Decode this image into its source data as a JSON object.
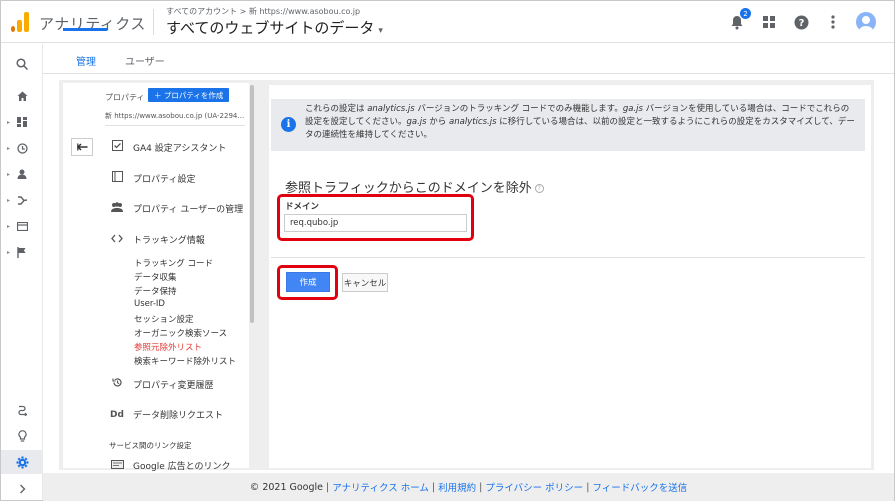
{
  "header": {
    "brand": "アナリティクス",
    "breadcrumb": "すべてのアカウント > 新 https://www.asobou.co.jp",
    "view_title": "すべてのウェブサイトのデータ",
    "notification_count": "2"
  },
  "tabs": [
    {
      "label": "管理",
      "active": true
    },
    {
      "label": "ユーザー",
      "active": false
    }
  ],
  "property": {
    "label": "プロパティ",
    "create_button": "＋ プロパティを作成",
    "url": "新 https://www.asobou.co.jp (UA-2294…",
    "items": [
      {
        "label": "GA4 設定アシスタント",
        "icon": "checkbox-icon"
      },
      {
        "label": "プロパティ設定",
        "icon": "square-icon"
      },
      {
        "label": "プロパティ ユーザーの管理",
        "icon": "users-icon"
      },
      {
        "label": "トラッキング情報",
        "icon": "code-icon"
      }
    ],
    "subitems": [
      "トラッキング コード",
      "データ収集",
      "データ保持",
      "User-ID",
      "セッション設定",
      "オーガニック検索ソース",
      "参照元除外リスト",
      "検索キーワード除外リスト"
    ],
    "active_subitem": "参照元除外リスト",
    "items_after": [
      {
        "label": "プロパティ変更履歴",
        "icon": "history-icon"
      },
      {
        "label": "データ削除リクエスト",
        "icon": "dd-icon"
      }
    ],
    "section_label": "サービス間のリンク設定",
    "link_item": {
      "label": "Google 広告とのリンク",
      "icon": "ads-icon"
    }
  },
  "notice": {
    "line1_a": "これらの設定は ",
    "line1_b": "analytics.js",
    "line1_c": " バージョンのトラッキング コードでのみ機能します。",
    "line1_d": "ga.js",
    "line1_e": " バージョンを使用している場合は、コードでこれらの",
    "line2_a": "設定を設定してください。",
    "line2_b": "ga.js",
    "line2_c": " から ",
    "line2_d": "analytics.js",
    "line2_e": " に移行している場合は、以前の設定と一致するようにこれらの設定をカスタマイズして、デー",
    "line3": "タの連続性を維持してください。"
  },
  "form": {
    "title": "参照トラフィックからこのドメインを除外",
    "domain_label": "ドメイン",
    "domain_value": "req.qubo.jp",
    "create_button": "作成",
    "cancel_button": "キャンセル"
  },
  "footer": {
    "copyright": "© 2021 Google",
    "links": [
      "アナリティクス ホーム",
      "利用規約",
      "プライバシー ポリシー",
      "フィードバックを送信"
    ]
  },
  "colors": {
    "accent": "#1a73e8",
    "highlight": "#e00010",
    "logo": "#f9ab00"
  }
}
